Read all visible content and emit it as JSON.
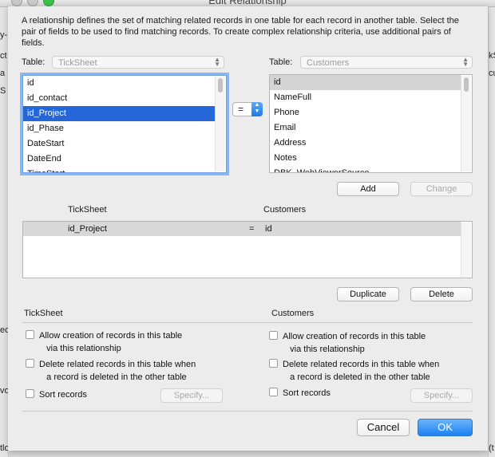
{
  "window": {
    "title": "Edit Relationship"
  },
  "dialog": {
    "intro": "A relationship defines the set of matching related records in one table for each record in another table. Select the pair of fields to be used to find matching records. To create complex relationship criteria, use additional pairs of fields.",
    "left": {
      "table_label": "Table:",
      "table_value": "TickSheet",
      "fields": [
        "id",
        "id_contact",
        "id_Project",
        "id_Phase",
        "DateStart",
        "DateEnd",
        "TimeStart"
      ],
      "selected_index": 2
    },
    "right": {
      "table_label": "Table:",
      "table_value": "Customers",
      "fields": [
        "id",
        "NameFull",
        "Phone",
        "Email",
        "Address",
        "Notes",
        "DBK_WebViewerSource"
      ],
      "selected_index": 0
    },
    "operator": "=",
    "buttons": {
      "add": "Add",
      "change": "Change",
      "duplicate": "Duplicate",
      "delete": "Delete",
      "cancel": "Cancel",
      "ok": "OK"
    },
    "relationships": {
      "left_header": "TickSheet",
      "right_header": "Customers",
      "rows": [
        {
          "left": "id_Project",
          "op": "=",
          "right": "id"
        }
      ]
    },
    "options": {
      "left_title": "TickSheet",
      "right_title": "Customers",
      "allow_creation": "Allow creation of records in this table",
      "allow_creation_2": "via this relationship",
      "delete_related": "Delete related records in this table when",
      "delete_related_2": "a record is deleted in the other table",
      "sort_records": "Sort records",
      "specify": "Specify..."
    }
  },
  "background": {
    "left_fragments": [
      "y-",
      "ct",
      "a",
      "S",
      "ec",
      "vo",
      "tlo"
    ],
    "right_fragments": [
      "kS",
      "cu",
      "(t"
    ]
  },
  "colors": {
    "selection": "#2566d8",
    "focus_ring": "#89b7f1",
    "primary_button": "#1a82f2"
  }
}
